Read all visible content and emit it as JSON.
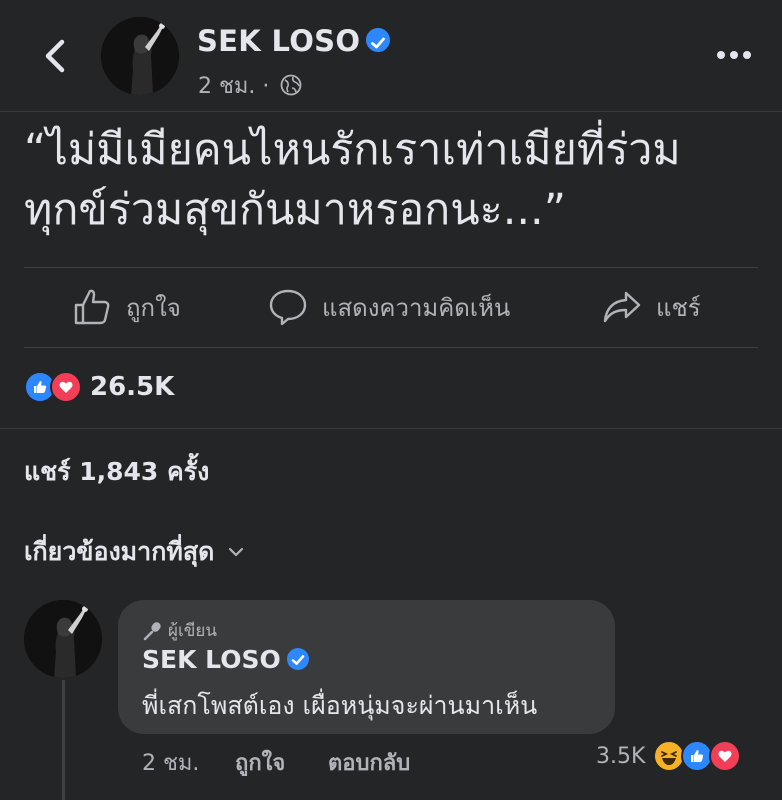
{
  "header": {
    "author": "SEK LOSO",
    "time": "2 ชม.",
    "dot": "·"
  },
  "post": {
    "text_line1": "“ไม่มีเมียคนไหนรักเราเท่าเมียที่ร่วม",
    "text_line2": "ทุกข์ร่วมสุขกันมาหรอกนะ...”"
  },
  "actions": {
    "like": "ถูกใจ",
    "comment": "แสดงความคิดเห็น",
    "share": "แชร์"
  },
  "reactions": {
    "count": "26.5K"
  },
  "shares": {
    "text": "แชร์ 1,843 ครั้ง"
  },
  "comments": {
    "sort_label": "เกี่ยวข้องมากที่สุด",
    "items": [
      {
        "badge": "ผู้เขียน",
        "author": "SEK LOSO",
        "text": "พี่เสกโพสต์เอง เผื่อหนุ่มจะผ่านมาเห็น",
        "time": "2 ชม.",
        "like": "ถูกใจ",
        "reply": "ตอบกลับ",
        "reaction_count": "3.5K"
      }
    ]
  },
  "colors": {
    "background": "#242526",
    "like_blue": "#2d88ff",
    "love_red": "#f33e58",
    "haha_yellow": "#f7b125"
  }
}
